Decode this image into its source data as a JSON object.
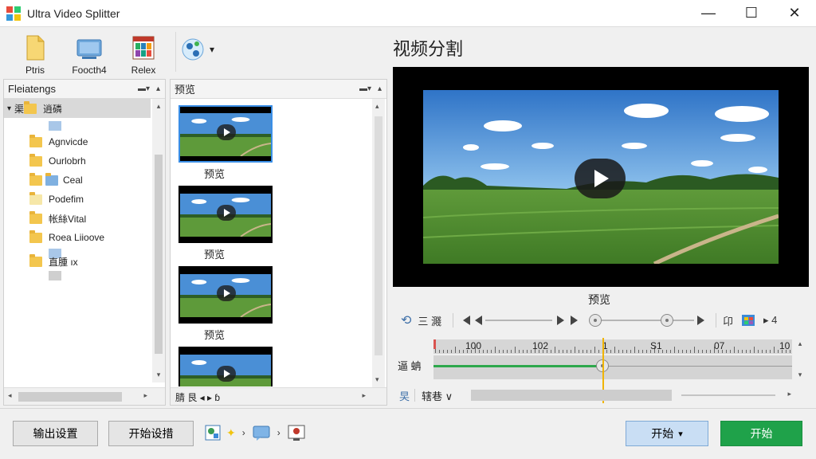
{
  "window": {
    "title": "Ultra Video Splitter",
    "minimize": "—",
    "maximize": "☐",
    "close": "✕"
  },
  "toolbar": {
    "items": [
      {
        "label": "Ptris",
        "icon": "document-icon"
      },
      {
        "label": "Foocth4",
        "icon": "monitor-icon"
      },
      {
        "label": "Relex",
        "icon": "film-icon"
      }
    ],
    "dropdown_icon": "globe-icon",
    "dropdown_caret": "▾"
  },
  "left_panel": {
    "header": "Fleiatengs",
    "root_label": "渠",
    "root_folder_label": "逍磷",
    "root_caret": "▾",
    "items": [
      {
        "label": "Agnvicde"
      },
      {
        "label": "Ourlobrh"
      },
      {
        "label": "Ceal"
      },
      {
        "label": "Podefim"
      },
      {
        "label": "帐絲Vital"
      },
      {
        "label": "Roea Liioove"
      },
      {
        "label": "直腫 ıx"
      }
    ]
  },
  "middle_panel": {
    "header": "预览",
    "thumbnails": [
      {
        "caption": "预览"
      },
      {
        "caption": "预览"
      },
      {
        "caption": "预览"
      },
      {
        "caption": ""
      }
    ],
    "footer_text": "腈 艮 ◂ ▸ ɓ"
  },
  "player": {
    "title": "视频分割",
    "preview_label": "预览",
    "controls_left": "三 濺",
    "controls_right_a": "卬",
    "controls_right_b": "▸ 4",
    "timeline_label": "逼 蚺",
    "ruler_numbers": [
      "100",
      "102",
      "1",
      "S1",
      "07",
      "10"
    ],
    "bottom_left": "旲",
    "bottom_mid": "辖巷 ∨",
    "progress": 0.47
  },
  "footer": {
    "output_settings": "输出设置",
    "start_settings": "开始设措",
    "start_dropdown": "开始",
    "start_dropdown_caret": "▾",
    "start": "开始"
  },
  "colors": {
    "accent": "#3a8ee6",
    "green": "#1fa24a",
    "playhead": "#f0b400",
    "timeline_green": "#2ea84c"
  }
}
